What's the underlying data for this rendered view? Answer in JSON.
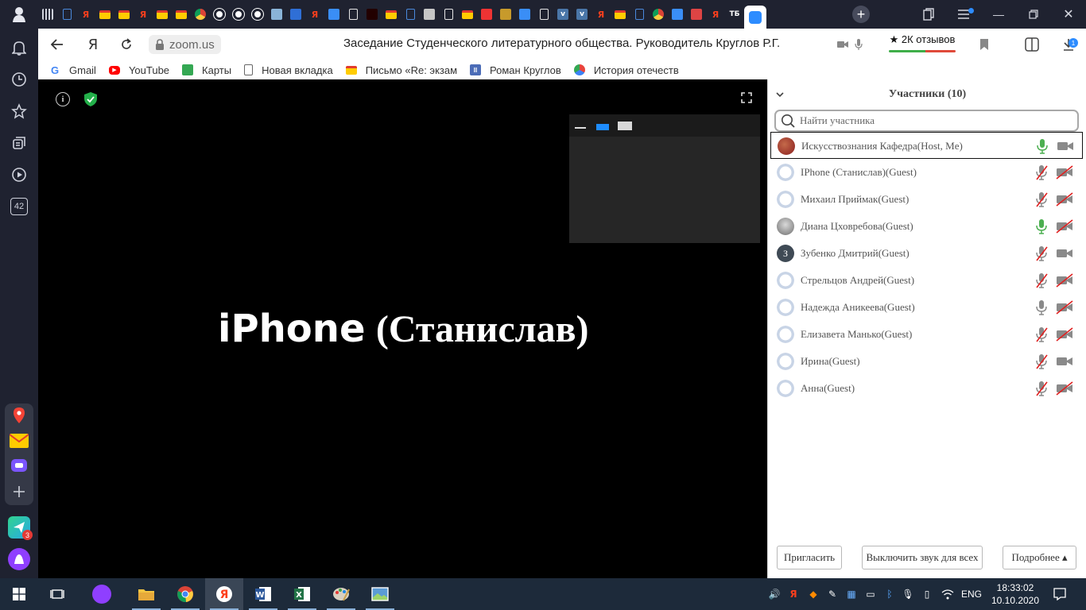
{
  "browser": {
    "tabs": [
      {
        "icon": "bars-icon",
        "color": "#cfd2dc"
      },
      {
        "icon": "doc-icon",
        "color": "#4a89dc"
      },
      {
        "icon": "yandex-icon",
        "color": "#fc3f1d"
      },
      {
        "icon": "mail-icon",
        "color": "#ffcc00"
      },
      {
        "icon": "mail-icon",
        "color": "#ffcc00"
      },
      {
        "icon": "yandex-icon",
        "color": "#fc3f1d"
      },
      {
        "icon": "mail-icon",
        "color": "#ffcc00"
      },
      {
        "icon": "mail-icon",
        "color": "#ffcc00"
      },
      {
        "icon": "chrome-icon",
        "color": "#34a853"
      },
      {
        "icon": "paw-icon",
        "color": "#ffffff"
      },
      {
        "icon": "paw-icon",
        "color": "#ffffff"
      },
      {
        "icon": "paw-icon",
        "color": "#ffffff"
      },
      {
        "icon": "badge-icon",
        "color": "#8ab4d8"
      },
      {
        "icon": "wing-icon",
        "color": "#2f6fd6"
      },
      {
        "icon": "yandex-icon",
        "color": "#fc3f1d"
      },
      {
        "icon": "chat-icon",
        "color": "#3a8ef6"
      },
      {
        "icon": "file-icon",
        "color": "#e6e6e6"
      },
      {
        "icon": "dark-icon",
        "color": "#220000"
      },
      {
        "icon": "mail-icon",
        "color": "#ffcc00"
      },
      {
        "icon": "doc-icon",
        "color": "#4a89dc"
      },
      {
        "icon": "image-icon",
        "color": "#c6c6c6"
      },
      {
        "icon": "file-icon",
        "color": "#e6e6e6"
      },
      {
        "icon": "mail-icon",
        "color": "#ffcc00"
      },
      {
        "icon": "pdf-icon",
        "color": "#e33"
      },
      {
        "icon": "book-icon",
        "color": "#c79a2b"
      },
      {
        "icon": "chat-icon",
        "color": "#3a8ef6"
      },
      {
        "icon": "file-icon",
        "color": "#e6e6e6"
      },
      {
        "icon": "vk-icon",
        "color": "#4a76a8"
      },
      {
        "icon": "vk-icon",
        "color": "#4a76a8"
      },
      {
        "icon": "yandex-icon",
        "color": "#fc3f1d"
      },
      {
        "icon": "mail-icon",
        "color": "#ffcc00"
      },
      {
        "icon": "doc-icon",
        "color": "#4a89dc"
      },
      {
        "icon": "chrome-icon",
        "color": "#34a853"
      },
      {
        "icon": "chat-icon",
        "color": "#3a8ef6"
      },
      {
        "icon": "grid-icon",
        "color": "#d44"
      },
      {
        "icon": "yandex-icon",
        "color": "#fc3f1d"
      },
      {
        "icon": "tb-icon",
        "color": "#ffffff",
        "label": "ТБ"
      },
      {
        "icon": "zoom-icon",
        "color": "#2d8cff",
        "active": true
      }
    ],
    "url_domain": "zoom.us",
    "page_title": "Заседание Студенческого литературного общества. Руководитель Круглов Р.Г.",
    "reviews_label": "★ 2К отзывов",
    "downloads_badge": "1",
    "bookmarks": [
      {
        "label": "Gmail",
        "icon": "google-icon"
      },
      {
        "label": "YouTube",
        "icon": "youtube-icon"
      },
      {
        "label": "Карты",
        "icon": "maps-icon"
      },
      {
        "label": "Новая вкладка",
        "icon": "page-icon"
      },
      {
        "label": "Письмо «Re: экзам",
        "icon": "mail-icon"
      },
      {
        "label": "Роман Круглов",
        "icon": "pause-icon"
      },
      {
        "label": "История отечеств",
        "icon": "hexagon-icon"
      }
    ]
  },
  "sidebar": {
    "badge_42": "42",
    "messenger_badge": "3"
  },
  "meeting": {
    "active_speaker_latin": "iPhone",
    "active_speaker_cyr": "(Станислав)"
  },
  "participants_panel": {
    "title": "Участники (10)",
    "search_placeholder": "Найти участника",
    "participants": [
      {
        "name": "Искусствознания Кафедра(Host, Me)",
        "avatar": "photo",
        "avatar_color": "#8b1f1f",
        "mic": "on",
        "video": "on"
      },
      {
        "name": "IPhone (Станислав)(Guest)",
        "avatar": "default",
        "mic": "muted",
        "video": "off"
      },
      {
        "name": "Михаил Приймак(Guest)",
        "avatar": "default",
        "mic": "muted",
        "video": "off"
      },
      {
        "name": "Диана Цховребова(Guest)",
        "avatar": "photo",
        "avatar_color": "#8a8a8a",
        "mic": "on",
        "video": "off"
      },
      {
        "name": "Зубенко Дмитрий(Guest)",
        "avatar": "letter",
        "avatar_letter": "З",
        "avatar_color": "#3f4a55",
        "mic": "muted",
        "video": "on"
      },
      {
        "name": "Стрельцов Андрей(Guest)",
        "avatar": "default",
        "mic": "muted",
        "video": "off"
      },
      {
        "name": "Надежда Аникеева(Guest)",
        "avatar": "default",
        "mic": "idle",
        "video": "off"
      },
      {
        "name": "Елизавета Манько(Guest)",
        "avatar": "default",
        "mic": "muted",
        "video": "off"
      },
      {
        "name": "Ирина(Guest)",
        "avatar": "default",
        "mic": "muted",
        "video": "on"
      },
      {
        "name": "Анна(Guest)",
        "avatar": "default",
        "mic": "muted",
        "video": "off"
      }
    ],
    "invite_label": "Пригласить",
    "mute_all_label": "Выключить звук для всех",
    "more_label": "Подробнее ▴"
  },
  "taskbar": {
    "language": "ENG",
    "time": "18:33:02",
    "date": "10.10.2020"
  },
  "colors": {
    "mic_active": "#4caf50",
    "muted_slash": "#e02020",
    "icon_gray": "#8a8a8a"
  }
}
